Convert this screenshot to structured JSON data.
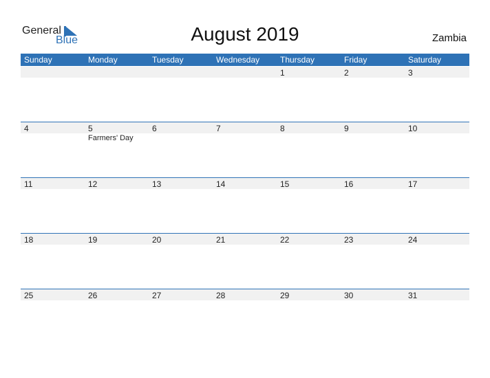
{
  "logo": {
    "line1": "General",
    "line2": "Blue"
  },
  "title": "August 2019",
  "country": "Zambia",
  "weekdays": [
    "Sunday",
    "Monday",
    "Tuesday",
    "Wednesday",
    "Thursday",
    "Friday",
    "Saturday"
  ],
  "weeks": [
    [
      "",
      "",
      "",
      "",
      "1",
      "2",
      "3"
    ],
    [
      "4",
      "5",
      "6",
      "7",
      "8",
      "9",
      "10"
    ],
    [
      "11",
      "12",
      "13",
      "14",
      "15",
      "16",
      "17"
    ],
    [
      "18",
      "19",
      "20",
      "21",
      "22",
      "23",
      "24"
    ],
    [
      "25",
      "26",
      "27",
      "28",
      "29",
      "30",
      "31"
    ]
  ],
  "events": {
    "w1d1": "Farmers' Day"
  },
  "colors": {
    "accent": "#2e72b6",
    "band": "#f1f1f1"
  }
}
